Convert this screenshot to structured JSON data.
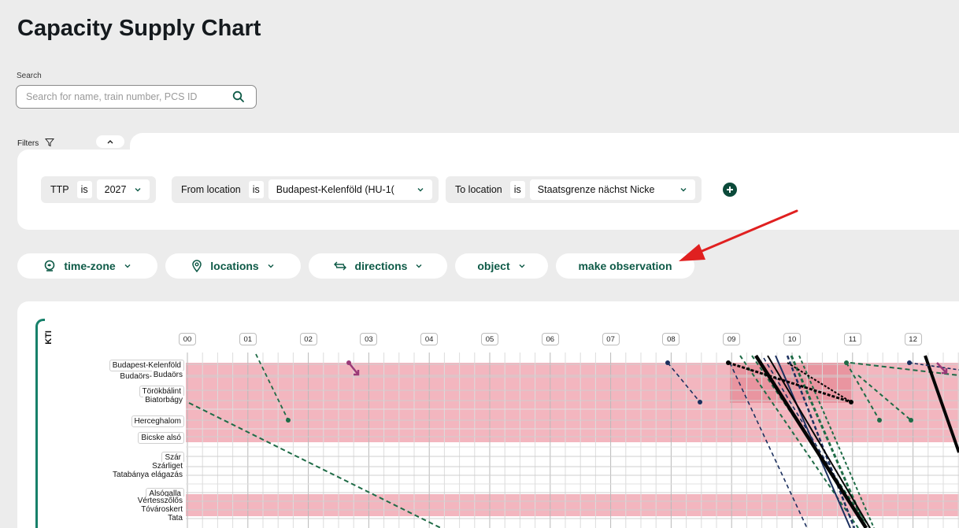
{
  "page": {
    "title": "Capacity Supply Chart"
  },
  "search": {
    "label": "Search",
    "placeholder": "Search for name, train number, PCS ID"
  },
  "filters": {
    "label": "Filters",
    "chips": [
      {
        "field": "TTP",
        "op": "is",
        "value": "2027"
      },
      {
        "field": "From location",
        "op": "is",
        "value": "Budapest-Kelenföld (HU-1("
      },
      {
        "field": "To location",
        "op": "is",
        "value": "Staatsgrenze nächst Nicke"
      }
    ]
  },
  "toolbar": {
    "timezone": "time-zone",
    "locations": "locations",
    "directions": "directions",
    "object": "object",
    "observation": "make observation"
  },
  "chart": {
    "side_label": "KTI",
    "hours": [
      "00",
      "01",
      "02",
      "03",
      "04",
      "05",
      "06",
      "07",
      "08",
      "09",
      "10",
      "11",
      "12"
    ],
    "locations": [
      "Budapest-Kelenföld",
      "Budaörs-",
      "Budaörs",
      "Törökbálint",
      "Biatorbágy",
      "Herceghalom",
      "Bicske alsó",
      "Szár",
      "Szárliget",
      "Tatabánya elágazás",
      "Alsógalla",
      "Vértesszőlős",
      "Tóvároskert",
      "Tata"
    ]
  },
  "colors": {
    "accent": "#0e5a47",
    "band": "#f3b6bf",
    "band_dark": "#e27e8c",
    "annotation_arrow": "#e02020"
  }
}
